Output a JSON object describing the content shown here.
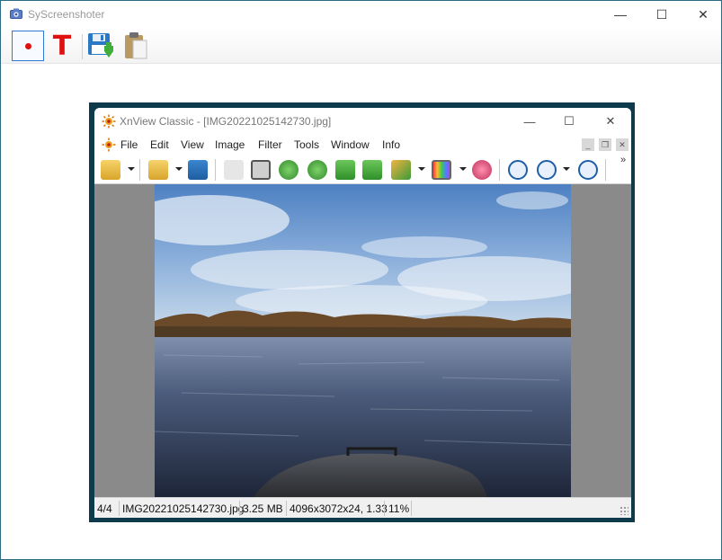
{
  "app": {
    "title": "SyScreenshoter",
    "icon": "camera-icon"
  },
  "window_controls": {
    "minimize": "—",
    "maximize": "☐",
    "close": "✕"
  },
  "toolbar": {
    "record_icon": "record-dot-icon",
    "text_label": "T",
    "save_icon": "floppy-save-icon",
    "paste_icon": "clipboard-icon"
  },
  "captured": {
    "title": "XnView Classic - [IMG20221025142730.jpg]",
    "menu": [
      "File",
      "Edit",
      "View",
      "Image",
      "Filter",
      "Tools",
      "Window",
      "Info"
    ],
    "mdi_controls": [
      "_",
      "❐",
      "✕"
    ],
    "toolbar_more": "»",
    "status": {
      "index": "4/4",
      "filename": "IMG20221025142730.jpg",
      "size": "3.25 MB",
      "dims": "4096x3072x24, 1.33",
      "zoom": "11%"
    },
    "colors": {
      "frame": "#0d3b4c",
      "viewer_bg": "#8a8a8a",
      "record": "#e01010"
    }
  }
}
